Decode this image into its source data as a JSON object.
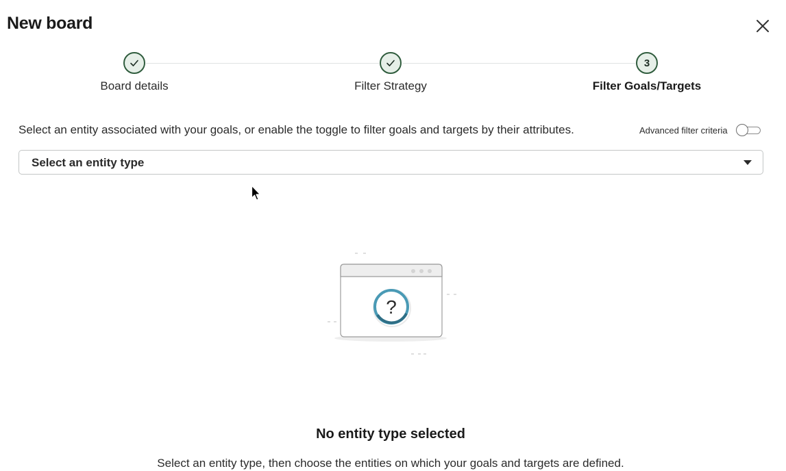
{
  "dialog": {
    "title": "New board",
    "close_icon": "close-icon"
  },
  "stepper": {
    "steps": [
      {
        "label": "Board details",
        "status": "complete",
        "icon": "checkmark-icon"
      },
      {
        "label": "Filter Strategy",
        "status": "complete",
        "icon": "checkmark-icon"
      },
      {
        "label": "Filter Goals/Targets",
        "status": "current",
        "number": "3"
      }
    ]
  },
  "filter": {
    "instruction": "Select an entity associated with your goals, or enable the toggle to filter goals and targets by their attributes.",
    "advanced_label": "Advanced filter criteria",
    "advanced_enabled": false,
    "entity_select_placeholder": "Select an entity type"
  },
  "empty_state": {
    "icon": "question-window-icon",
    "title": "No entity type selected",
    "description": "Select an entity type, then choose the entities on which your goals and targets are defined."
  },
  "colors": {
    "step_complete_border": "#2f5c3d",
    "step_complete_fill": "#e6efe8",
    "illustration_accent": "#4a9ab5"
  }
}
